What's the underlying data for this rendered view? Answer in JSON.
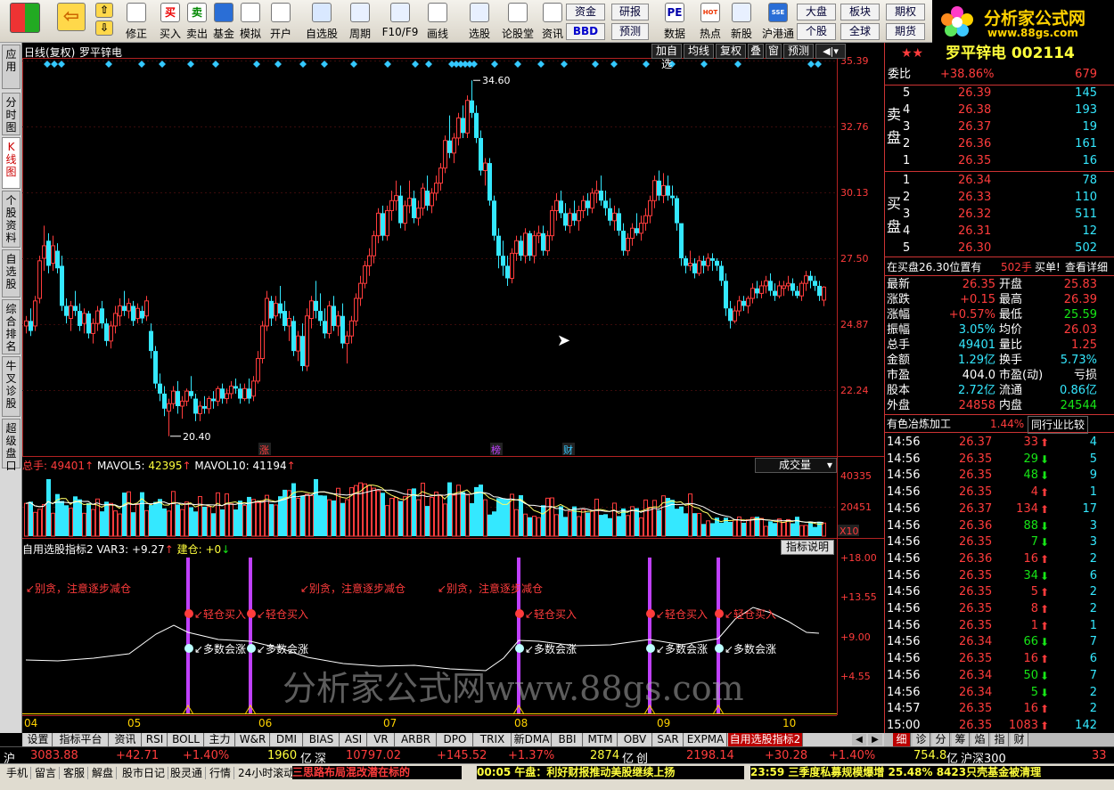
{
  "toolbar": {
    "buttons": [
      {
        "label": "修正",
        "icon": "refresh-icon"
      },
      {
        "label": "买入",
        "icon": "buy-icon",
        "glyph": "买"
      },
      {
        "label": "卖出",
        "icon": "sell-icon",
        "glyph": "卖"
      },
      {
        "label": "基金",
        "icon": "fund-icon"
      },
      {
        "label": "模拟",
        "icon": "hammer-icon"
      },
      {
        "label": "开户",
        "icon": "lock-icon"
      },
      {
        "label": "自选股",
        "icon": "star-icon"
      },
      {
        "label": "周期",
        "icon": "clock-icon"
      },
      {
        "label": "F10/F9",
        "icon": "document-icon"
      },
      {
        "label": "画线",
        "icon": "pencil-icon"
      },
      {
        "label": "选股",
        "icon": "filter-icon"
      },
      {
        "label": "论股堂",
        "icon": "forum-icon"
      },
      {
        "label": "资讯",
        "icon": "news-icon"
      },
      {
        "label": "数据",
        "icon": "pe-icon",
        "glyph": "PE"
      },
      {
        "label": "热点",
        "icon": "fire-icon",
        "glyph": "HOT"
      },
      {
        "label": "新股",
        "icon": "ipo-icon"
      },
      {
        "label": "沪港通",
        "icon": "hk-connect-icon",
        "glyph": "SSE HKE"
      }
    ],
    "small": {
      "zijin": "资金",
      "bbd": "BBD",
      "yanbao": "研报",
      "yuce": "预测",
      "dapan": "大盘",
      "gegu": "个股",
      "bankuai": "板块",
      "quanqiu": "全球",
      "qiquan": "期权",
      "qihuo": "期货"
    }
  },
  "logo": {
    "text": "分析家公式网",
    "url_text": "www.88gs.com"
  },
  "left_tabs": [
    "应用",
    "分时图",
    "K线图",
    "个股资料",
    "自选股",
    "综合排名",
    "牛叉诊股",
    "超级盘口"
  ],
  "chart": {
    "header": {
      "mode": "日线(复权)",
      "stock": "罗平锌电",
      "buttons": [
        "加自选",
        "均线",
        "复权",
        "叠",
        "窗",
        "预测"
      ]
    },
    "price_axis": [
      "35.39",
      "32.76",
      "30.13",
      "27.50",
      "24.87",
      "22.24"
    ],
    "high_label": "34.60",
    "low_label": "20.40",
    "markers": [
      "涨",
      "榜",
      "财"
    ],
    "volume": {
      "label": "总手",
      "value": "49401",
      "mavol5_label": "MAVOL5",
      "mavol5": "42395",
      "mavol10_label": "MAVOL10",
      "mavol10": "41194",
      "dropdown": "成交量",
      "axis": [
        "40335",
        "20451"
      ],
      "unit": "X10"
    },
    "indicator": {
      "name": "自用选股指标2",
      "var3_label": "VAR3",
      "var3": "+9.27",
      "jiancang_label": "建仓",
      "jiancang": "+0",
      "button": "指标说明",
      "axis": [
        "+18.00",
        "+13.55",
        "+9.00",
        "+4.55"
      ],
      "sell_signal": "↙别贪，注意逐步减仓",
      "light_buy": "↙轻仓买入",
      "many_rise": "↙多数会涨"
    },
    "months": [
      "04",
      "05",
      "06",
      "07",
      "08",
      "09",
      "10"
    ],
    "watermark": "分析家公式网www.88gs.com"
  },
  "right": {
    "title": "罗平锌电 002114",
    "weibi_label": "委比",
    "weibi": "+38.86%",
    "weicha": "679",
    "sell_label": "卖盘",
    "buy_label": "买盘",
    "asks": [
      {
        "lvl": "5",
        "price": "26.39",
        "vol": "145"
      },
      {
        "lvl": "4",
        "price": "26.38",
        "vol": "193"
      },
      {
        "lvl": "3",
        "price": "26.37",
        "vol": "19"
      },
      {
        "lvl": "2",
        "price": "26.36",
        "vol": "161"
      },
      {
        "lvl": "1",
        "price": "26.35",
        "vol": "16"
      }
    ],
    "bids": [
      {
        "lvl": "1",
        "price": "26.34",
        "vol": "78"
      },
      {
        "lvl": "2",
        "price": "26.33",
        "vol": "110"
      },
      {
        "lvl": "3",
        "price": "26.32",
        "vol": "511"
      },
      {
        "lvl": "4",
        "price": "26.31",
        "vol": "12"
      },
      {
        "lvl": "5",
        "price": "26.30",
        "vol": "502"
      }
    ],
    "notice": {
      "text": "在买盘26.30位置有",
      "vol": "502手",
      "buy": "买单!",
      "detail": "查看详细"
    },
    "quote": [
      [
        "最新",
        "26.35",
        "red",
        "开盘",
        "25.83",
        "red"
      ],
      [
        "涨跌",
        "+0.15",
        "red",
        "最高",
        "26.39",
        "red"
      ],
      [
        "涨幅",
        "+0.57%",
        "red",
        "最低",
        "25.59",
        "green"
      ],
      [
        "振幅",
        "3.05%",
        "cyan",
        "均价",
        "26.03",
        "red"
      ],
      [
        "总手",
        "49401",
        "cyan",
        "量比",
        "1.25",
        "red"
      ],
      [
        "金额",
        "1.29亿",
        "cyan",
        "换手",
        "5.73%",
        "cyan"
      ],
      [
        "市盈",
        "404.0",
        "white",
        "市盈(动)",
        "亏损",
        "white"
      ],
      [
        "股本",
        "2.72亿",
        "cyan",
        "流通",
        "0.86亿",
        "cyan"
      ],
      [
        "外盘",
        "24858",
        "red",
        "内盘",
        "24544",
        "green"
      ]
    ],
    "industry": {
      "name": "有色冶炼加工",
      "pct": "1.44%",
      "compare": "同行业比较"
    },
    "ticks": [
      {
        "t": "14:56",
        "p": "26.37",
        "pc": "red",
        "v": "33",
        "d": "up",
        "n": "4"
      },
      {
        "t": "14:56",
        "p": "26.35",
        "pc": "red",
        "v": "29",
        "d": "down",
        "n": "5"
      },
      {
        "t": "14:56",
        "p": "26.35",
        "pc": "red",
        "v": "48",
        "d": "down",
        "n": "9"
      },
      {
        "t": "14:56",
        "p": "26.35",
        "pc": "red",
        "v": "4",
        "d": "up",
        "n": "1"
      },
      {
        "t": "14:56",
        "p": "26.37",
        "pc": "red",
        "v": "134",
        "d": "up",
        "n": "17"
      },
      {
        "t": "14:56",
        "p": "26.36",
        "pc": "red",
        "v": "88",
        "d": "down",
        "n": "3"
      },
      {
        "t": "14:56",
        "p": "26.35",
        "pc": "red",
        "v": "7",
        "d": "down",
        "n": "3"
      },
      {
        "t": "14:56",
        "p": "26.36",
        "pc": "red",
        "v": "16",
        "d": "up",
        "n": "2"
      },
      {
        "t": "14:56",
        "p": "26.35",
        "pc": "red",
        "v": "34",
        "d": "down",
        "n": "6"
      },
      {
        "t": "14:56",
        "p": "26.35",
        "pc": "red",
        "v": "5",
        "d": "up",
        "n": "2"
      },
      {
        "t": "14:56",
        "p": "26.35",
        "pc": "red",
        "v": "8",
        "d": "up",
        "n": "2"
      },
      {
        "t": "14:56",
        "p": "26.35",
        "pc": "red",
        "v": "1",
        "d": "up",
        "n": "1"
      },
      {
        "t": "14:56",
        "p": "26.34",
        "pc": "red",
        "v": "66",
        "d": "down",
        "n": "7"
      },
      {
        "t": "14:56",
        "p": "26.35",
        "pc": "red",
        "v": "16",
        "d": "up",
        "n": "6"
      },
      {
        "t": "14:56",
        "p": "26.34",
        "pc": "red",
        "v": "50",
        "d": "down",
        "n": "7"
      },
      {
        "t": "14:56",
        "p": "26.34",
        "pc": "red",
        "v": "5",
        "d": "down",
        "n": "2"
      },
      {
        "t": "14:57",
        "p": "26.35",
        "pc": "red",
        "v": "16",
        "d": "up",
        "n": "2"
      },
      {
        "t": "15:00",
        "p": "26.35",
        "pc": "red",
        "v": "1083",
        "d": "up",
        "n": "142"
      }
    ]
  },
  "bottom_tabs": [
    "设置",
    "指标平台",
    "资讯",
    "RSI",
    "BOLL",
    "主力",
    "W&R",
    "DMI",
    "BIAS",
    "ASI",
    "VR",
    "ARBR",
    "DPO",
    "TRIX",
    "新DMA",
    "BBI",
    "MTM",
    "OBV",
    "SAR",
    "EXPMA",
    "自用选股指标2"
  ],
  "right_tabs": [
    "细",
    "诊",
    "分",
    "筹",
    "焰",
    "指",
    "财"
  ],
  "index_bar": {
    "sh_label": "沪",
    "sh": "3083.88",
    "sh_chg": "+42.71",
    "sh_pct": "+1.40%",
    "sh_amt": "1960",
    "yi": "亿",
    "sz_label": "深",
    "sz": "10797.02",
    "sz_chg": "+145.52",
    "sz_pct": "+1.37%",
    "sz_amt": "2874",
    "cy_label": "创",
    "cy": "2198.14",
    "cy_chg": "+30.28",
    "cy_pct": "+1.40%",
    "cy_amt": "754.8",
    "hs300": "沪深300",
    "last": "33"
  },
  "status_bar": {
    "cells": [
      "手机",
      "留言",
      "客服",
      "解盘",
      "股市日记",
      "股灵通",
      "行情",
      "24小时滚动"
    ],
    "news1": "三思路布局混改潜在标的",
    "news2": "00:05 午盘：利好财报推动美股继续上扬",
    "news3": "23:59 三季度私募规模爆增 25.48% 8423只壳基金被清理"
  },
  "colors": {
    "up": "#ff3c3c",
    "down": "#34e8ff",
    "purple": "#c040ff",
    "ma": "#ffffff"
  }
}
